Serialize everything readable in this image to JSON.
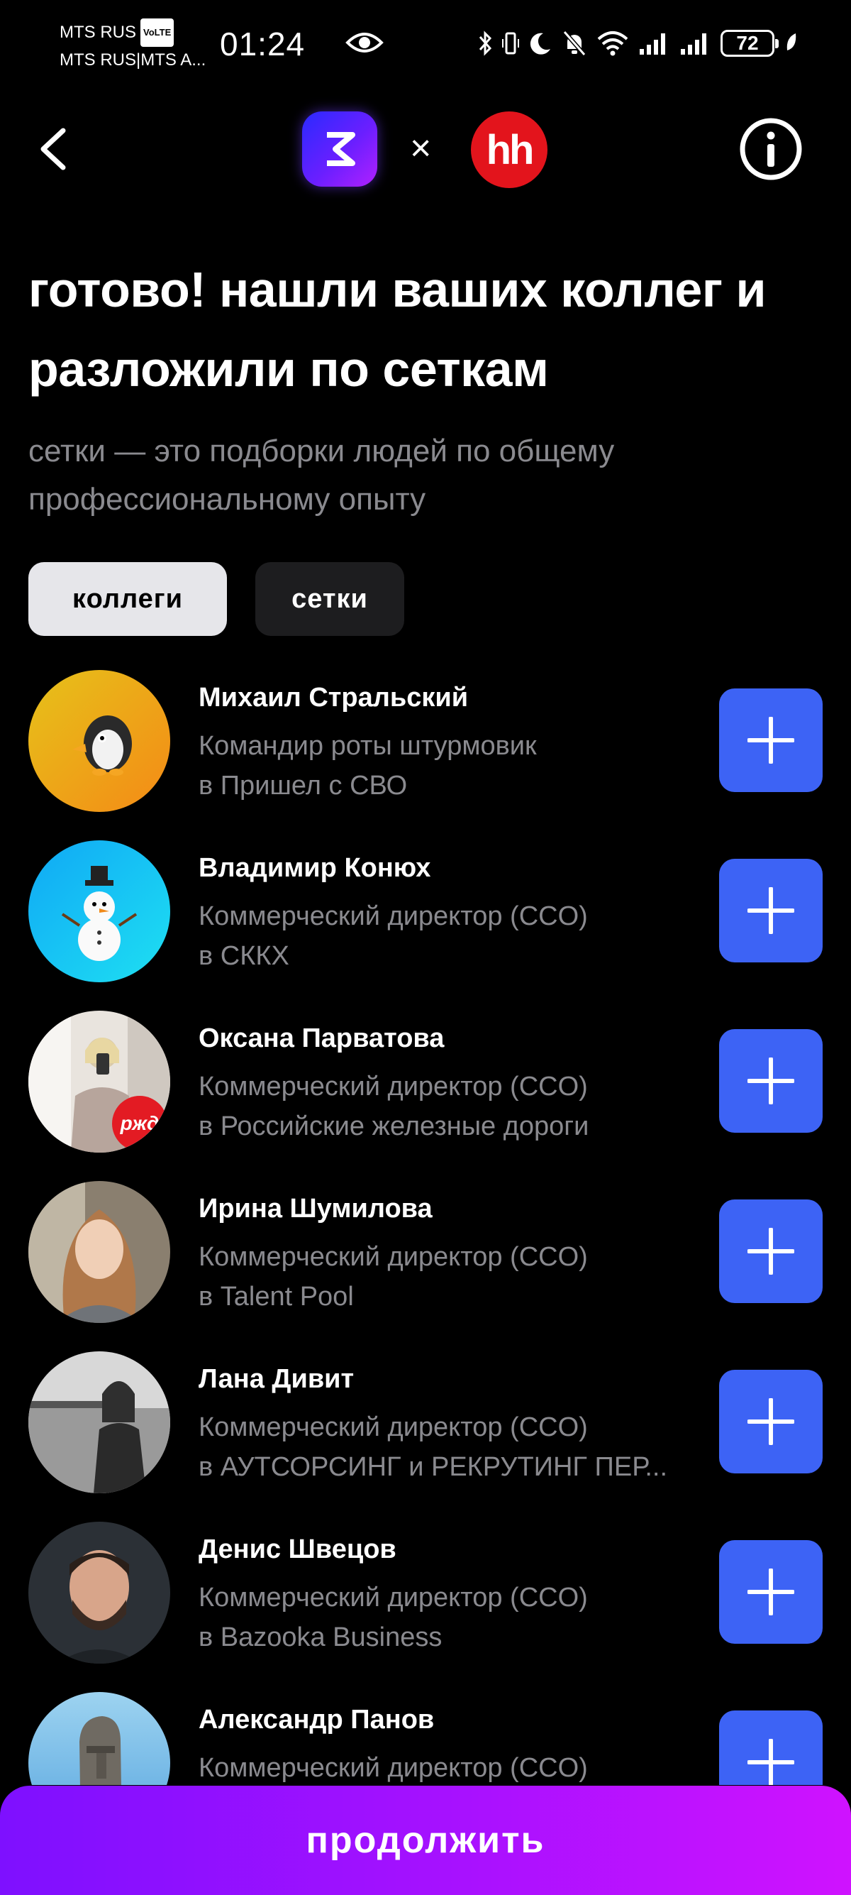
{
  "status_bar": {
    "carrier_line1": "MTS RUS",
    "volte_badge": "VoLTE",
    "carrier_line2": "MTS RUS|MTS A...",
    "time": "01:24",
    "battery_level": "72"
  },
  "header": {
    "times_sign": "×",
    "hh_logo_text": "hh"
  },
  "title": "готово! нашли ваших коллег и разложили по сеткам",
  "subtitle": "сетки — это подборки людей по общему профессиональному опыту",
  "tabs": {
    "colleagues": "коллеги",
    "grids": "сетки",
    "active": "colleagues"
  },
  "people": [
    {
      "name": "Михаил Стральский",
      "role": "Командир роты штурмовик",
      "company": "в Пришел с СВО",
      "avatar": "penguin-emoji"
    },
    {
      "name": "Владимир Конюх",
      "role": "Коммерческий директор (CCO)",
      "company": "в СККХ",
      "avatar": "snowman-emoji"
    },
    {
      "name": "Оксана Парватова",
      "role": "Коммерческий директор (CCO)",
      "company": "в Российские железные дороги",
      "avatar": "photo-woman-mirror",
      "badge": "ржд"
    },
    {
      "name": "Ирина Шумилова",
      "role": "Коммерческий директор (CCO)",
      "company": "в Talent Pool",
      "avatar": "photo-woman"
    },
    {
      "name": "Лана Дивит",
      "role": "Коммерческий директор (CCO)",
      "company": "в АУТСОРСИНГ и РЕКРУТИНГ ПЕР...",
      "avatar": "photo-woman-bw"
    },
    {
      "name": "Денис Швецов",
      "role": "Коммерческий директор (CCO)",
      "company": "в Bazooka Business",
      "avatar": "photo-man"
    },
    {
      "name": "Александр Панов",
      "role": "Коммерческий директор (CCO)",
      "company": "",
      "avatar": "moai-statue"
    }
  ],
  "continue_label": "продолжить",
  "colors": {
    "accent_blue": "#3d63f5",
    "continue_gradient_start": "#7e10ff",
    "continue_gradient_end": "#cf12ff",
    "hh_red": "#e3141c",
    "muted_text": "#8a8a8f"
  }
}
